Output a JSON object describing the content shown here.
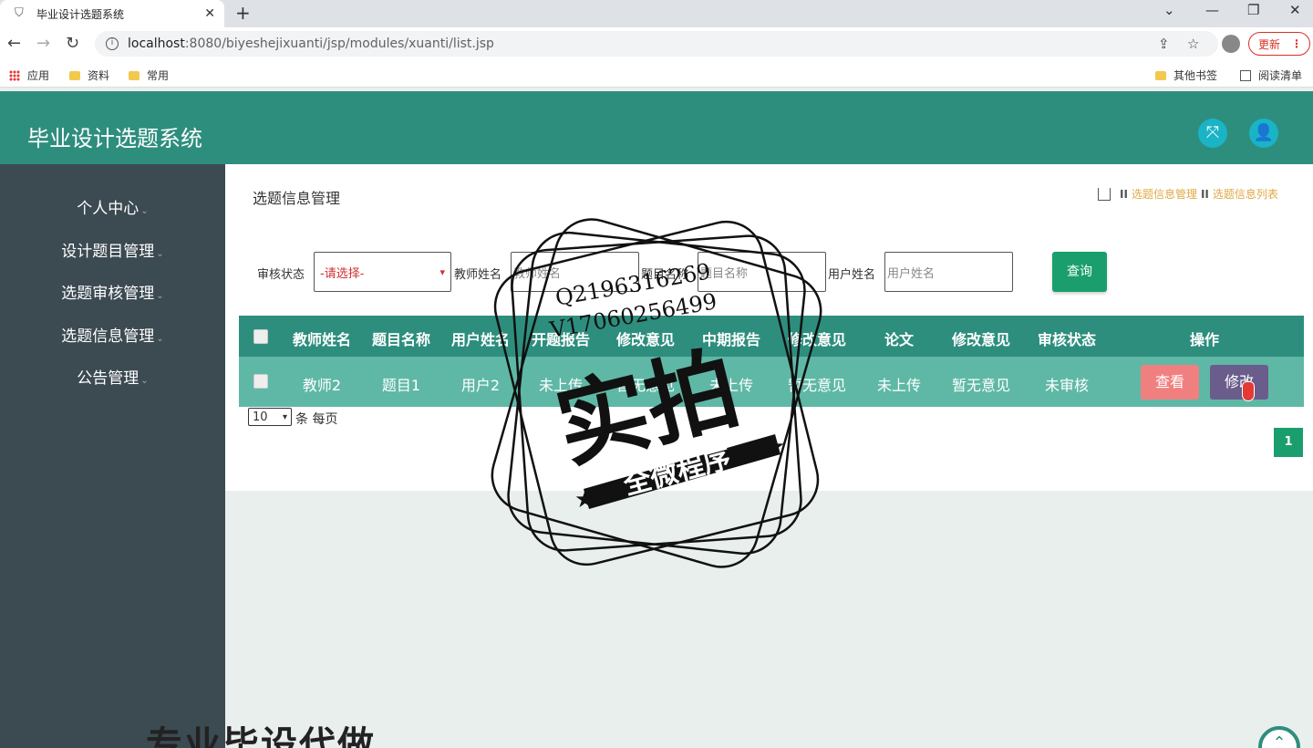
{
  "browser": {
    "tab_title": "毕业设计选题系统",
    "url_host": "localhost",
    "url_rest": ":8080/biyeshejixuanti/jsp/modules/xuanti/list.jsp",
    "update_label": "更新",
    "bookmarks": [
      "应用",
      "资料",
      "常用"
    ],
    "bookmarks_right": [
      "其他书签",
      "阅读清单"
    ]
  },
  "app": {
    "title": "毕业设计选题系统"
  },
  "sidebar": {
    "items": [
      {
        "label": "个人中心"
      },
      {
        "label": "设计题目管理"
      },
      {
        "label": "选题审核管理"
      },
      {
        "label": "选题信息管理"
      },
      {
        "label": "公告管理"
      }
    ]
  },
  "page": {
    "title": "选题信息管理",
    "breadcrumb": [
      "选题信息管理",
      "选题信息列表"
    ]
  },
  "filters": {
    "status_label": "审核状态",
    "status_value": "-请选择-",
    "teacher_label": "教师姓名",
    "teacher_placeholder": "教师姓名",
    "topic_label": "题目名称",
    "topic_placeholder": "题目名称",
    "user_label": "用户姓名",
    "user_placeholder": "用户姓名",
    "query_label": "查询"
  },
  "table": {
    "headers": [
      "教师姓名",
      "题目名称",
      "用户姓名",
      "开题报告",
      "修改意见",
      "中期报告",
      "修改意见",
      "论文",
      "修改意见",
      "审核状态",
      "操作"
    ],
    "rows": [
      {
        "cells": [
          "教师2",
          "题目1",
          "用户2",
          "未上传",
          "暂无意见",
          "未上传",
          "暂无意见",
          "未上传",
          "暂无意见",
          "未审核"
        ],
        "view_label": "查看",
        "edit_label": "修改"
      }
    ]
  },
  "pagination": {
    "page_size": "10",
    "page_size_suffix": "条 每页",
    "current_page": "1"
  },
  "watermark": {
    "qq": "Q2196316269",
    "vx": "V17060256499",
    "big": "实拍",
    "banner": "全微程序",
    "bottom": "专业毕设代做"
  },
  "colors": {
    "header": "#2e8e7e",
    "sidebar": "#3c4a52",
    "table_header": "#2e8e7e",
    "table_row": "#5fb8a6",
    "query_button": "#1a9e6e",
    "view_button": "#f08080",
    "edit_button": "#6a5d8c",
    "breadcrumb_link": "#e0a844"
  }
}
